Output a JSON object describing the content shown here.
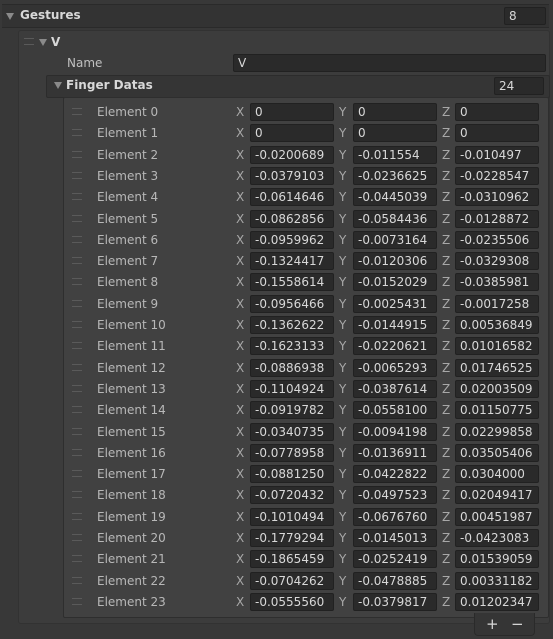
{
  "gestures": {
    "label": "Gestures",
    "size": "8"
  },
  "gesture": {
    "title": "V",
    "name_label": "Name",
    "name_value": "V",
    "finger_datas": {
      "label": "Finger Datas",
      "size": "24"
    }
  },
  "axes": {
    "x": "X",
    "y": "Y",
    "z": "Z"
  },
  "elements": [
    {
      "label": "Element 0",
      "x": "0",
      "y": "0",
      "z": "0"
    },
    {
      "label": "Element 1",
      "x": "0",
      "y": "0",
      "z": "0"
    },
    {
      "label": "Element 2",
      "x": "-0.0200689",
      "y": "-0.011554",
      "z": "-0.010497"
    },
    {
      "label": "Element 3",
      "x": "-0.0379103",
      "y": "-0.0236625",
      "z": "-0.0228547"
    },
    {
      "label": "Element 4",
      "x": "-0.0614646",
      "y": "-0.0445039",
      "z": "-0.0310962"
    },
    {
      "label": "Element 5",
      "x": "-0.0862856",
      "y": "-0.0584436",
      "z": "-0.0128872"
    },
    {
      "label": "Element 6",
      "x": "-0.0959962",
      "y": "-0.0073164",
      "z": "-0.0235506"
    },
    {
      "label": "Element 7",
      "x": "-0.1324417",
      "y": "-0.0120306",
      "z": "-0.0329308"
    },
    {
      "label": "Element 8",
      "x": "-0.1558614",
      "y": "-0.0152029",
      "z": "-0.0385981"
    },
    {
      "label": "Element 9",
      "x": "-0.0956466",
      "y": "-0.0025431",
      "z": "-0.0017258"
    },
    {
      "label": "Element 10",
      "x": "-0.1362622",
      "y": "-0.0144915",
      "z": "0.00536849"
    },
    {
      "label": "Element 11",
      "x": "-0.1623133",
      "y": "-0.0220621",
      "z": "0.01016582"
    },
    {
      "label": "Element 12",
      "x": "-0.0886938",
      "y": "-0.0065293",
      "z": "0.01746525"
    },
    {
      "label": "Element 13",
      "x": "-0.1104924",
      "y": "-0.0387614",
      "z": "0.02003509"
    },
    {
      "label": "Element 14",
      "x": "-0.0919782",
      "y": "-0.0558100",
      "z": "0.01150775"
    },
    {
      "label": "Element 15",
      "x": "-0.0340735",
      "y": "-0.0094198",
      "z": "0.02299858"
    },
    {
      "label": "Element 16",
      "x": "-0.0778958",
      "y": "-0.0136911",
      "z": "0.03505406"
    },
    {
      "label": "Element 17",
      "x": "-0.0881250",
      "y": "-0.0422822",
      "z": "0.0304000"
    },
    {
      "label": "Element 18",
      "x": "-0.0720432",
      "y": "-0.0497523",
      "z": "0.02049417"
    },
    {
      "label": "Element 19",
      "x": "-0.1010494",
      "y": "-0.0676760",
      "z": "0.00451987"
    },
    {
      "label": "Element 20",
      "x": "-0.1779294",
      "y": "-0.0145013",
      "z": "-0.0423083"
    },
    {
      "label": "Element 21",
      "x": "-0.1865459",
      "y": "-0.0252419",
      "z": "0.01539059"
    },
    {
      "label": "Element 22",
      "x": "-0.0704262",
      "y": "-0.0478885",
      "z": "0.00331182"
    },
    {
      "label": "Element 23",
      "x": "-0.0555560",
      "y": "-0.0379817",
      "z": "0.01202347"
    }
  ],
  "footer": {
    "add_label": "+",
    "remove_label": "−"
  }
}
